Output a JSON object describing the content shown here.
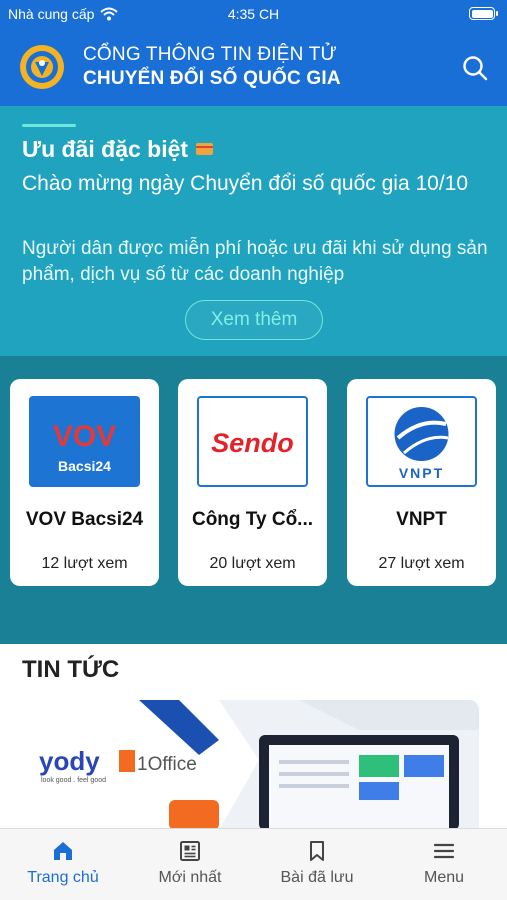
{
  "status_bar": {
    "carrier": "Nhà cung cấp",
    "time": "4:35 CH"
  },
  "header": {
    "title_line1": "CỔNG THÔNG TIN ĐIỆN TỬ",
    "title_line2": "CHUYỂN ĐỔI SỐ QUỐC GIA"
  },
  "promo": {
    "title": "Ưu đãi đặc biệt",
    "subtitle": "Chào mừng ngày Chuyển đổi số quốc gia 10/10",
    "description": "Người dân được miễn phí hoặc ưu đãi khi sử dụng sản phẩm, dịch vụ số từ các doanh nghiệp",
    "button_label": "Xem thêm"
  },
  "partners": [
    {
      "name": "VOV Bacsi24",
      "views": "12 lượt xem",
      "logo_text_top": "VOV",
      "logo_text_bottom": "Bacsi24"
    },
    {
      "name": "Công Ty Cổ...",
      "views": "20 lượt xem",
      "logo_text_top": "Sendo"
    },
    {
      "name": "VNPT",
      "views": "27 lượt xem",
      "logo_text_top": "VNPT"
    }
  ],
  "news": {
    "section_title": "TIN TỨC",
    "image_brand_1": "yody",
    "image_brand_1_tagline": "look good . feel good",
    "image_brand_2": "1Office"
  },
  "bottom_nav": [
    {
      "label": "Trang chủ",
      "icon": "home-icon",
      "active": true
    },
    {
      "label": "Mới nhất",
      "icon": "newspaper-icon",
      "active": false
    },
    {
      "label": "Bài đã lưu",
      "icon": "bookmark-icon",
      "active": false
    },
    {
      "label": "Menu",
      "icon": "menu-icon",
      "active": false
    }
  ],
  "colors": {
    "header_blue": "#1a6fd6",
    "promo_teal": "#1fa3be",
    "cards_bg": "#1a8096",
    "accent_mint": "#6ee8dc"
  }
}
